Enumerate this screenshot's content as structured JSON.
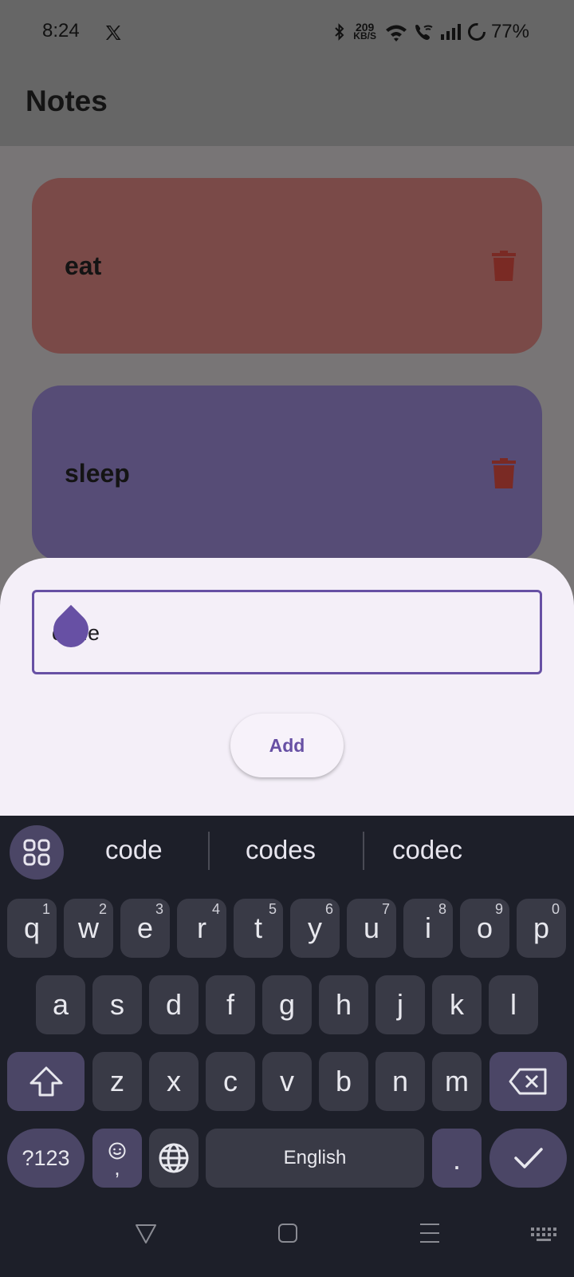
{
  "status_bar": {
    "time": "8:24",
    "net_speed_value": "209",
    "net_speed_unit": "KB/S",
    "battery": "77%",
    "icons": [
      "x-app-icon",
      "bluetooth-icon",
      "wifi-icon",
      "wifi-call-icon",
      "signal-icon",
      "battery-ring-icon"
    ]
  },
  "app_bar": {
    "title": "Notes"
  },
  "notes": [
    {
      "text": "eat",
      "color": "#7a4a48",
      "icon": "trash-icon"
    },
    {
      "text": "sleep",
      "color": "#564c76",
      "icon": "trash-icon"
    }
  ],
  "sheet": {
    "input_value": "code",
    "add_label": "Add",
    "accent": "#6750a4"
  },
  "keyboard": {
    "suggestions": [
      "code",
      "codes",
      "codec"
    ],
    "row1": [
      {
        "k": "q",
        "h": "1"
      },
      {
        "k": "w",
        "h": "2"
      },
      {
        "k": "e",
        "h": "3"
      },
      {
        "k": "r",
        "h": "4"
      },
      {
        "k": "t",
        "h": "5"
      },
      {
        "k": "y",
        "h": "6"
      },
      {
        "k": "u",
        "h": "7"
      },
      {
        "k": "i",
        "h": "8"
      },
      {
        "k": "o",
        "h": "9"
      },
      {
        "k": "p",
        "h": "0"
      }
    ],
    "row2": [
      "a",
      "s",
      "d",
      "f",
      "g",
      "h",
      "j",
      "k",
      "l"
    ],
    "row3": [
      "z",
      "x",
      "c",
      "v",
      "b",
      "n",
      "m"
    ],
    "symbols_label": "?123",
    "emoji_comma": ",",
    "space_label": "English",
    "period": "."
  }
}
